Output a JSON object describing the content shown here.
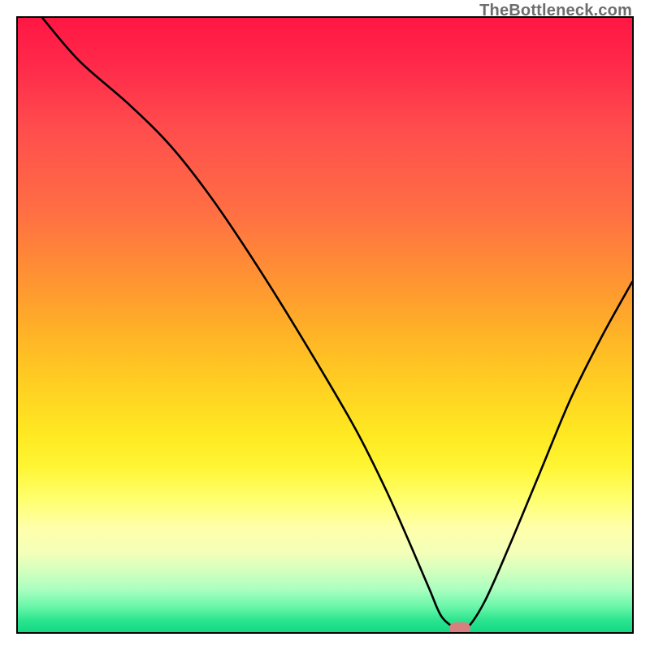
{
  "watermark": "TheBottleneck.com",
  "chart_data": {
    "type": "line",
    "title": "",
    "xlabel": "",
    "ylabel": "",
    "xlim": [
      0,
      100
    ],
    "ylim": [
      0,
      100
    ],
    "grid": false,
    "legend": false,
    "gradient_stops": [
      {
        "pos": 0,
        "color": "#ff1744"
      },
      {
        "pos": 8,
        "color": "#ff2a4a"
      },
      {
        "pos": 18,
        "color": "#ff4d4d"
      },
      {
        "pos": 32,
        "color": "#ff7043"
      },
      {
        "pos": 44,
        "color": "#ff9830"
      },
      {
        "pos": 52,
        "color": "#ffb526"
      },
      {
        "pos": 60,
        "color": "#ffd022"
      },
      {
        "pos": 68,
        "color": "#ffe922"
      },
      {
        "pos": 73,
        "color": "#fff533"
      },
      {
        "pos": 78,
        "color": "#ffff6a"
      },
      {
        "pos": 83,
        "color": "#ffffaa"
      },
      {
        "pos": 87,
        "color": "#f4ffb8"
      },
      {
        "pos": 90,
        "color": "#d4ffbe"
      },
      {
        "pos": 93,
        "color": "#aaffc0"
      },
      {
        "pos": 96,
        "color": "#66f5a8"
      },
      {
        "pos": 98,
        "color": "#2de58f"
      },
      {
        "pos": 100,
        "color": "#14d884"
      }
    ],
    "series": [
      {
        "name": "bottleneck-curve",
        "color": "#000000",
        "x": [
          4,
          10,
          18,
          25,
          32,
          40,
          48,
          55,
          60,
          64,
          67,
          69,
          71.5,
          73,
          76,
          80,
          85,
          90,
          95,
          100
        ],
        "y": [
          100,
          93,
          86,
          79,
          70,
          58,
          45,
          33,
          23,
          14,
          7,
          2.5,
          0.5,
          0.5,
          5,
          14,
          26,
          38,
          48,
          57
        ]
      }
    ],
    "marker": {
      "x": 72,
      "y": 0.5,
      "color": "#d88080",
      "shape": "rounded-rect"
    }
  }
}
